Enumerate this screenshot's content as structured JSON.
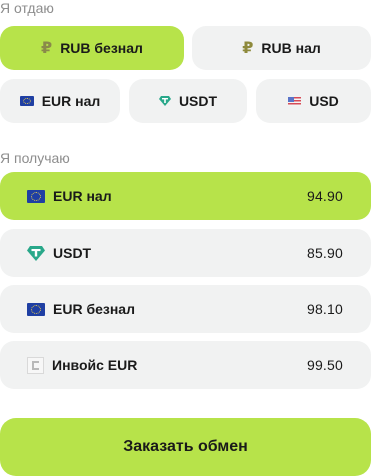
{
  "give": {
    "label": "Я отдаю",
    "options": [
      {
        "label": "RUB безнал",
        "icon": "ruble-icon",
        "selected": true
      },
      {
        "label": "RUB нал",
        "icon": "ruble-icon",
        "selected": false
      },
      {
        "label": "EUR нал",
        "icon": "eu-flag-icon",
        "selected": false
      },
      {
        "label": "USDT",
        "icon": "tether-icon",
        "selected": false
      },
      {
        "label": "USD",
        "icon": "us-flag-icon",
        "selected": false
      }
    ]
  },
  "receive": {
    "label": "Я получаю",
    "options": [
      {
        "label": "EUR нал",
        "rate": "94.90",
        "icon": "eu-flag-icon",
        "selected": true
      },
      {
        "label": "USDT",
        "rate": "85.90",
        "icon": "tether-icon",
        "selected": false
      },
      {
        "label": "EUR безнал",
        "rate": "98.10",
        "icon": "eu-flag-icon",
        "selected": false
      },
      {
        "label": "Инвойс EUR",
        "rate": "99.50",
        "icon": "invoice-icon",
        "selected": false
      }
    ]
  },
  "order_button": {
    "label": "Заказать обмен"
  },
  "colors": {
    "accent": "#b7e34a",
    "inactive": "#f1f2f2",
    "muted_text": "#8d8d8d"
  }
}
